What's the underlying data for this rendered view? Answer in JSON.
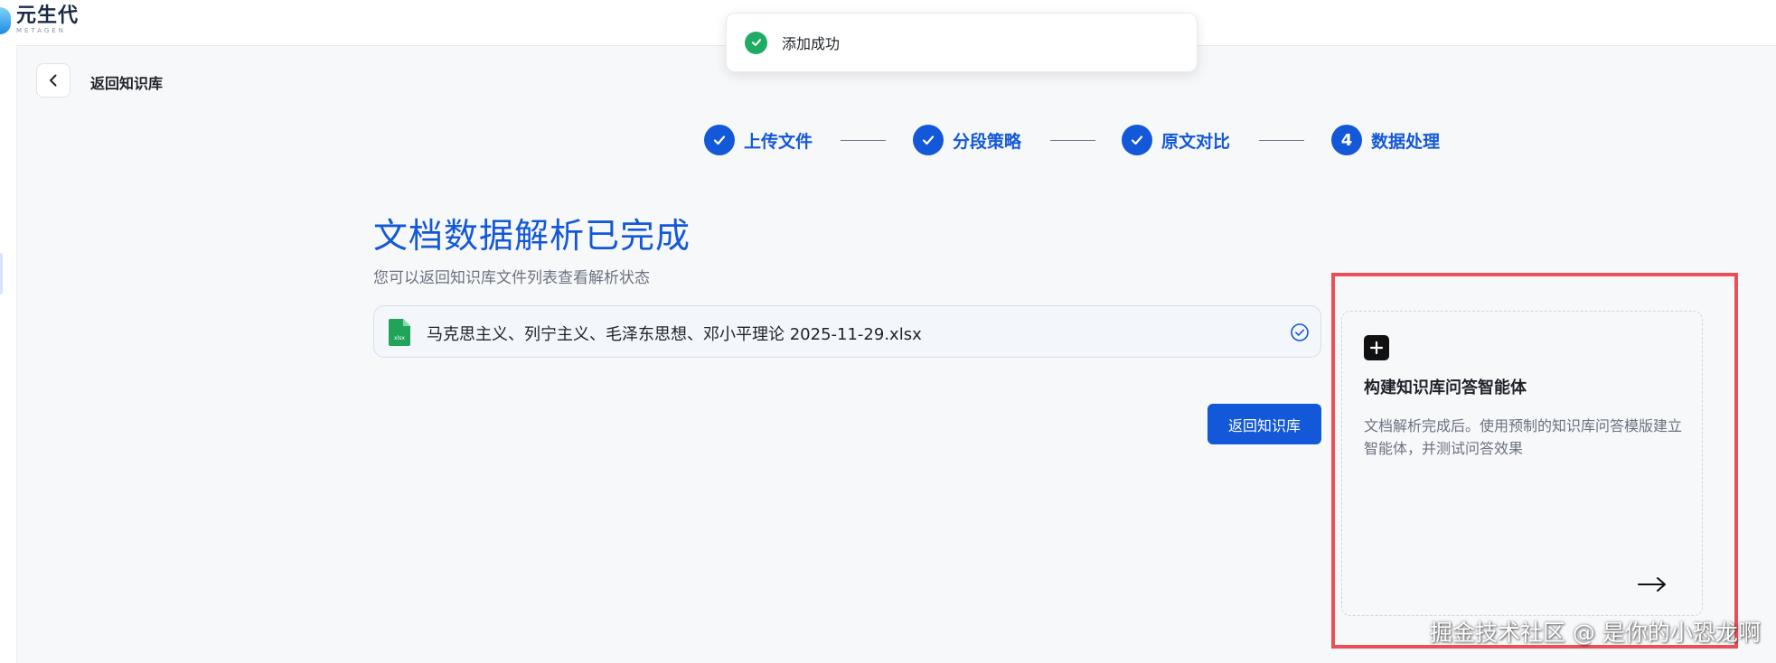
{
  "app": {
    "logo_cn": "元生代",
    "logo_en": "METAGEN"
  },
  "header": {
    "back_label": "返回知识库"
  },
  "toast": {
    "message": "添加成功",
    "icon": "check-circle-icon",
    "color": "#1eab63"
  },
  "steps": [
    {
      "label": "上传文件",
      "state": "done"
    },
    {
      "label": "分段策略",
      "state": "done"
    },
    {
      "label": "原文对比",
      "state": "done"
    },
    {
      "label": "数据处理",
      "number": "4",
      "state": "current"
    }
  ],
  "main": {
    "title": "文档数据解析已完成",
    "subtitle": "您可以返回知识库文件列表查看解析状态",
    "file": {
      "name": "马克思主义、列宁主义、毛泽东思想、邓小平理论 2025-11-29.xlsx",
      "type_badge": "xlsx",
      "status_icon": "check-circle-outline-icon"
    },
    "back_button": "返回知识库"
  },
  "agent_card": {
    "title": "构建知识库问答智能体",
    "description": "文档解析完成后。使用预制的知识库问答模版建立智能体，并测试问答效果"
  },
  "watermark": "掘金技术社区 @ 是你的小恐龙啊",
  "colors": {
    "primary": "#1358d8",
    "success": "#1eab63",
    "highlight_border": "#ea4f58"
  }
}
